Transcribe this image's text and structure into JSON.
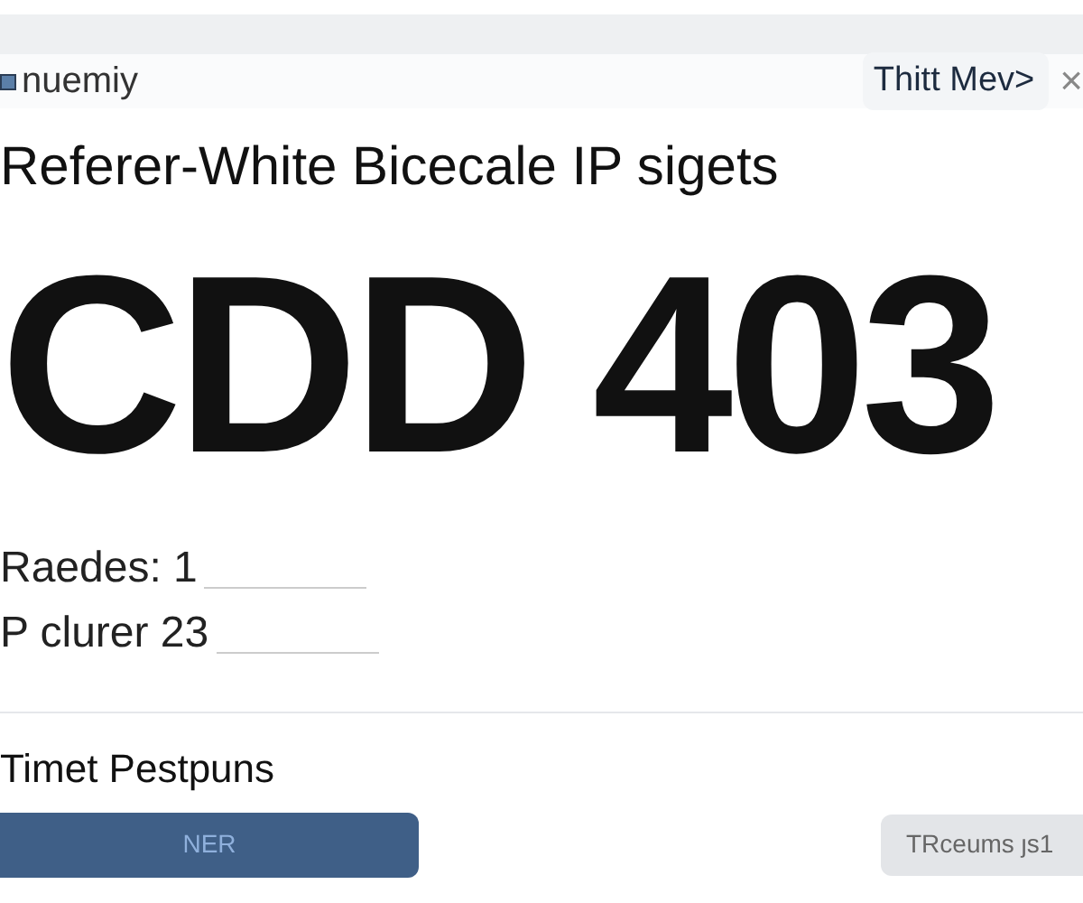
{
  "header": {
    "brand": "nuemiy",
    "tab": "Thitt Mev>",
    "close": "×"
  },
  "heading": "Referer-White Bicecale IP sigets",
  "code": "CDD 403",
  "fields": [
    {
      "label": "Raedes: 1"
    },
    {
      "label": "P clurer 23"
    }
  ],
  "section_title": "Timet Pestpuns",
  "buttons": [
    {
      "label": "NER",
      "kind": "primary"
    },
    {
      "label": "TRceums ȷs1",
      "kind": "secondary"
    }
  ]
}
